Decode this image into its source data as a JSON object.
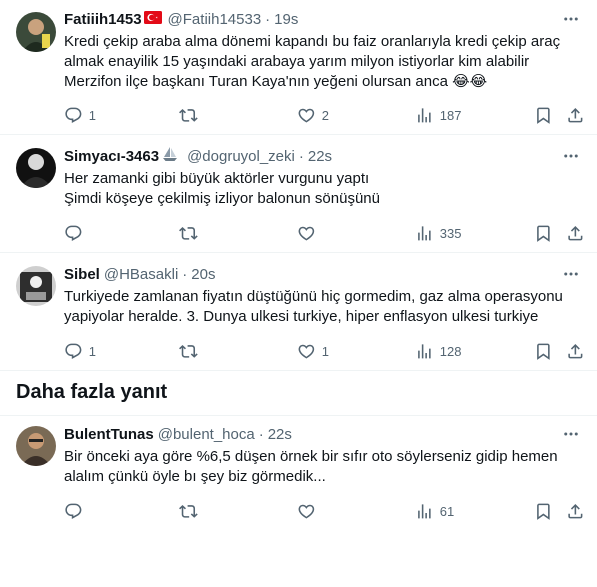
{
  "tweets": [
    {
      "name": "Fatiiih1453",
      "badge": "turkey-flag",
      "handle": "@Fatiih14533",
      "sep": "·",
      "time": "19s",
      "lines": [
        "Kredi çekip araba alma dönemi kapandı bu faiz oranlarıyla kredi çekip araç",
        "almak enayilik 15 yaşındaki arabaya yarım milyon istiyorlar kim alabilir",
        "Merzifon ilçe başkanı Turan Kaya'nın yeğeni olursan anca"
      ],
      "emoji": "😂😂",
      "replies": "1",
      "retweets": "",
      "likes": "2",
      "views": "187"
    },
    {
      "name": "Simyacı-3463",
      "badge": "sailboat",
      "handle": "@dogruyol_zeki",
      "sep": "·",
      "time": "22s",
      "lines": [
        "Her zamanki gibi büyük aktörler vurgunu yaptı",
        "Şimdi köşeye çekilmiş izliyor balonun sönüşünü"
      ],
      "replies": "",
      "retweets": "",
      "likes": "",
      "views": "335"
    },
    {
      "name": "Sibel",
      "handle": "@HBasakli",
      "sep": "·",
      "time": "20s",
      "lines": [
        "Turkiyede zamlanan fiyatın düştüğünü hiç gormedim, gaz alma operasyonu",
        "yapiyolar heralde. 3. Dunya ulkesi turkiye, hiper enflasyon ulkesi turkiye"
      ],
      "replies": "1",
      "retweets": "",
      "likes": "1",
      "views": "128"
    },
    {
      "name": "BulentTunas",
      "handle": "@bulent_hoca",
      "sep": "·",
      "time": "22s",
      "lines": [
        "Bir önceki aya göre %6,5 düşen örnek bir sıfır oto söylerseniz gidip hemen",
        "alalım çünkü öyle bı şey biz görmedik..."
      ],
      "replies": "",
      "retweets": "",
      "likes": "",
      "views": "61"
    }
  ],
  "section_title": "Daha fazla yanıt",
  "colors": {
    "text": "#0f1419",
    "muted": "#536471",
    "border": "#eff3f4"
  }
}
